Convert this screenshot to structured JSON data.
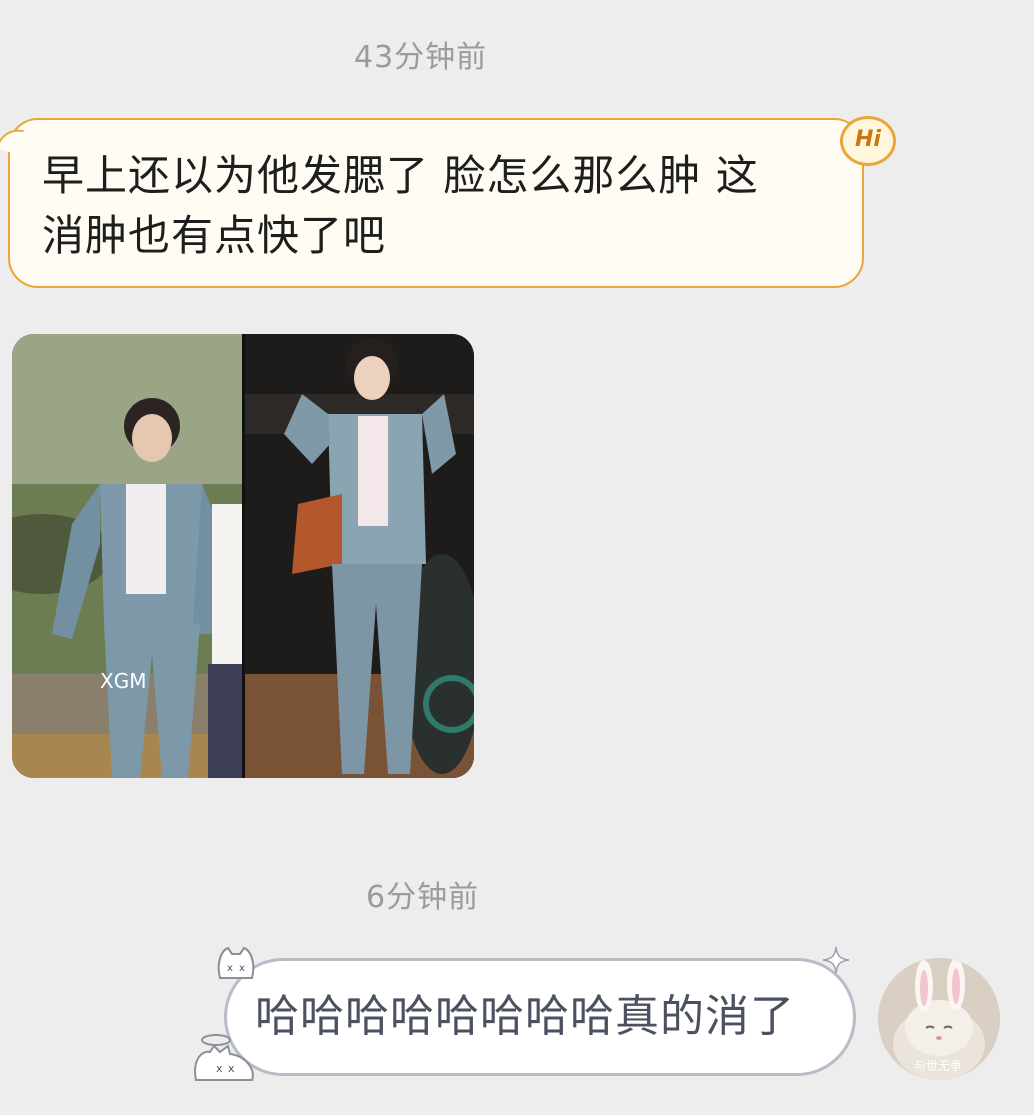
{
  "conversation": {
    "messages": [
      {
        "timestamp": "43分钟前",
        "direction": "incoming",
        "text_line1": "早上还以为他发腮了 脸怎么那么肿 这",
        "text_line2": "消肿也有点快了吧",
        "badge": "Hi"
      },
      {
        "direction": "incoming",
        "type": "image",
        "watermark": "XGM"
      },
      {
        "timestamp": "6分钟前",
        "direction": "outgoing",
        "text": "哈哈哈哈哈哈哈哈真的消了",
        "avatar_caption": "与世无争"
      }
    ]
  },
  "colors": {
    "background": "#ededed",
    "incoming_bubble_fill": "#fffdf3",
    "incoming_bubble_border": "#e9a73a",
    "outgoing_bubble_fill": "#ffffff",
    "outgoing_bubble_border": "#b7bcc8",
    "timestamp_text": "#9b9b9b"
  },
  "icons": {
    "hi_badge": "hi-badge-icon",
    "cat_sticker_top": "cat-face-icon",
    "cat_sticker_bottom": "cat-lying-icon",
    "sparkle": "sparkle-icon"
  }
}
